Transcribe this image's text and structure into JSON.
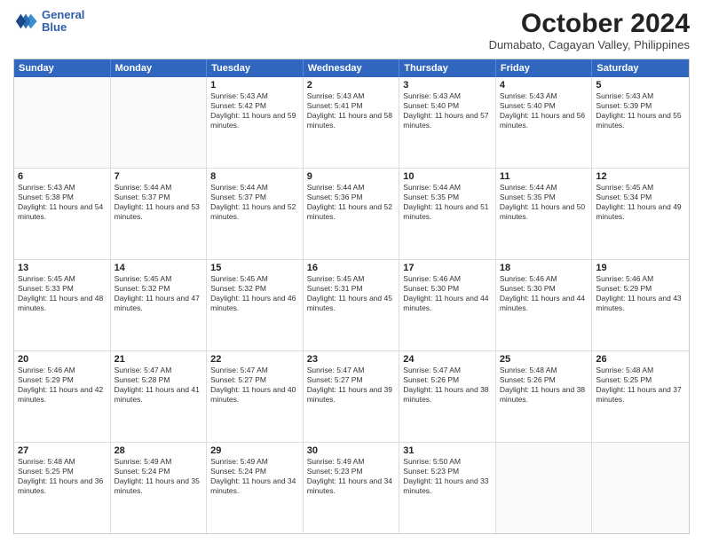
{
  "header": {
    "logo_line1": "General",
    "logo_line2": "Blue",
    "month": "October 2024",
    "location": "Dumabato, Cagayan Valley, Philippines"
  },
  "days_of_week": [
    "Sunday",
    "Monday",
    "Tuesday",
    "Wednesday",
    "Thursday",
    "Friday",
    "Saturday"
  ],
  "weeks": [
    [
      {
        "day": "",
        "text": ""
      },
      {
        "day": "",
        "text": ""
      },
      {
        "day": "1",
        "text": "Sunrise: 5:43 AM\nSunset: 5:42 PM\nDaylight: 11 hours and 59 minutes."
      },
      {
        "day": "2",
        "text": "Sunrise: 5:43 AM\nSunset: 5:41 PM\nDaylight: 11 hours and 58 minutes."
      },
      {
        "day": "3",
        "text": "Sunrise: 5:43 AM\nSunset: 5:40 PM\nDaylight: 11 hours and 57 minutes."
      },
      {
        "day": "4",
        "text": "Sunrise: 5:43 AM\nSunset: 5:40 PM\nDaylight: 11 hours and 56 minutes."
      },
      {
        "day": "5",
        "text": "Sunrise: 5:43 AM\nSunset: 5:39 PM\nDaylight: 11 hours and 55 minutes."
      }
    ],
    [
      {
        "day": "6",
        "text": "Sunrise: 5:43 AM\nSunset: 5:38 PM\nDaylight: 11 hours and 54 minutes."
      },
      {
        "day": "7",
        "text": "Sunrise: 5:44 AM\nSunset: 5:37 PM\nDaylight: 11 hours and 53 minutes."
      },
      {
        "day": "8",
        "text": "Sunrise: 5:44 AM\nSunset: 5:37 PM\nDaylight: 11 hours and 52 minutes."
      },
      {
        "day": "9",
        "text": "Sunrise: 5:44 AM\nSunset: 5:36 PM\nDaylight: 11 hours and 52 minutes."
      },
      {
        "day": "10",
        "text": "Sunrise: 5:44 AM\nSunset: 5:35 PM\nDaylight: 11 hours and 51 minutes."
      },
      {
        "day": "11",
        "text": "Sunrise: 5:44 AM\nSunset: 5:35 PM\nDaylight: 11 hours and 50 minutes."
      },
      {
        "day": "12",
        "text": "Sunrise: 5:45 AM\nSunset: 5:34 PM\nDaylight: 11 hours and 49 minutes."
      }
    ],
    [
      {
        "day": "13",
        "text": "Sunrise: 5:45 AM\nSunset: 5:33 PM\nDaylight: 11 hours and 48 minutes."
      },
      {
        "day": "14",
        "text": "Sunrise: 5:45 AM\nSunset: 5:32 PM\nDaylight: 11 hours and 47 minutes."
      },
      {
        "day": "15",
        "text": "Sunrise: 5:45 AM\nSunset: 5:32 PM\nDaylight: 11 hours and 46 minutes."
      },
      {
        "day": "16",
        "text": "Sunrise: 5:45 AM\nSunset: 5:31 PM\nDaylight: 11 hours and 45 minutes."
      },
      {
        "day": "17",
        "text": "Sunrise: 5:46 AM\nSunset: 5:30 PM\nDaylight: 11 hours and 44 minutes."
      },
      {
        "day": "18",
        "text": "Sunrise: 5:46 AM\nSunset: 5:30 PM\nDaylight: 11 hours and 44 minutes."
      },
      {
        "day": "19",
        "text": "Sunrise: 5:46 AM\nSunset: 5:29 PM\nDaylight: 11 hours and 43 minutes."
      }
    ],
    [
      {
        "day": "20",
        "text": "Sunrise: 5:46 AM\nSunset: 5:29 PM\nDaylight: 11 hours and 42 minutes."
      },
      {
        "day": "21",
        "text": "Sunrise: 5:47 AM\nSunset: 5:28 PM\nDaylight: 11 hours and 41 minutes."
      },
      {
        "day": "22",
        "text": "Sunrise: 5:47 AM\nSunset: 5:27 PM\nDaylight: 11 hours and 40 minutes."
      },
      {
        "day": "23",
        "text": "Sunrise: 5:47 AM\nSunset: 5:27 PM\nDaylight: 11 hours and 39 minutes."
      },
      {
        "day": "24",
        "text": "Sunrise: 5:47 AM\nSunset: 5:26 PM\nDaylight: 11 hours and 38 minutes."
      },
      {
        "day": "25",
        "text": "Sunrise: 5:48 AM\nSunset: 5:26 PM\nDaylight: 11 hours and 38 minutes."
      },
      {
        "day": "26",
        "text": "Sunrise: 5:48 AM\nSunset: 5:25 PM\nDaylight: 11 hours and 37 minutes."
      }
    ],
    [
      {
        "day": "27",
        "text": "Sunrise: 5:48 AM\nSunset: 5:25 PM\nDaylight: 11 hours and 36 minutes."
      },
      {
        "day": "28",
        "text": "Sunrise: 5:49 AM\nSunset: 5:24 PM\nDaylight: 11 hours and 35 minutes."
      },
      {
        "day": "29",
        "text": "Sunrise: 5:49 AM\nSunset: 5:24 PM\nDaylight: 11 hours and 34 minutes."
      },
      {
        "day": "30",
        "text": "Sunrise: 5:49 AM\nSunset: 5:23 PM\nDaylight: 11 hours and 34 minutes."
      },
      {
        "day": "31",
        "text": "Sunrise: 5:50 AM\nSunset: 5:23 PM\nDaylight: 11 hours and 33 minutes."
      },
      {
        "day": "",
        "text": ""
      },
      {
        "day": "",
        "text": ""
      }
    ]
  ]
}
